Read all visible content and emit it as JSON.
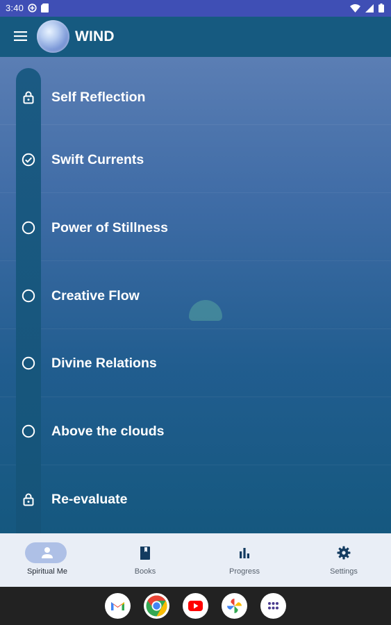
{
  "status": {
    "time": "3:40"
  },
  "app": {
    "title": "WIND"
  },
  "chapters": [
    {
      "label": "Self Reflection",
      "state": "locked"
    },
    {
      "label": "Swift Currents",
      "state": "completed"
    },
    {
      "label": "Power of Stillness",
      "state": "open"
    },
    {
      "label": "Creative Flow",
      "state": "open"
    },
    {
      "label": "Divine Relations",
      "state": "open"
    },
    {
      "label": "Above the clouds",
      "state": "open"
    },
    {
      "label": "Re-evaluate",
      "state": "locked"
    }
  ],
  "nav": [
    {
      "label": "Spiritual Me",
      "icon": "person-icon",
      "active": true
    },
    {
      "label": "Books",
      "icon": "book-icon",
      "active": false
    },
    {
      "label": "Progress",
      "icon": "bar-chart-icon",
      "active": false
    },
    {
      "label": "Settings",
      "icon": "gear-icon",
      "active": false
    }
  ],
  "dock": [
    "gmail-icon",
    "chrome-icon",
    "youtube-icon",
    "photos-icon",
    "app-drawer-icon"
  ],
  "colors": {
    "status_bar": "#3f4fb5",
    "app_bar": "#165a80",
    "nav_pill": "#aec0e6"
  }
}
